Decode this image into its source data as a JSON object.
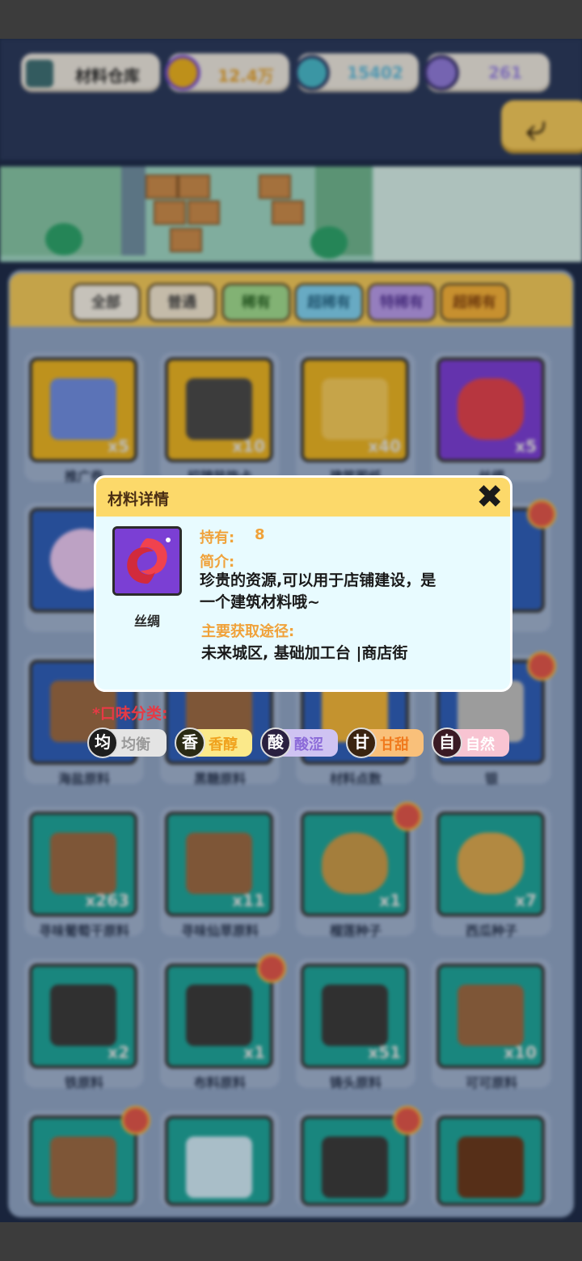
{
  "resources": {
    "warehouse_label": "材料仓库",
    "coins": "12.4万",
    "potion": "15402",
    "gems": "261"
  },
  "tabs": [
    "全部",
    "普通",
    "稀有",
    "超稀有",
    "特稀有",
    "超稀有"
  ],
  "grid": {
    "row1": [
      {
        "name": "推广券",
        "qty": "x5"
      },
      {
        "name": "招牌装饰卡",
        "qty": "x10"
      },
      {
        "name": "建筑图纸",
        "qty": "x40"
      },
      {
        "name": "丝绸",
        "qty": "x5"
      }
    ],
    "row3_names": [
      "海盐原料",
      "黑糖原料",
      "材料点数",
      "银"
    ],
    "row4": [
      {
        "name": "寻味葡萄干原料",
        "qty": "x263"
      },
      {
        "name": "寻味仙草原料",
        "qty": "x11"
      },
      {
        "name": "榴莲种子",
        "qty": "x1"
      },
      {
        "name": "西瓜种子",
        "qty": "x7"
      }
    ],
    "row5": [
      {
        "name": "铁原料",
        "qty": "x2"
      },
      {
        "name": "布料原料",
        "qty": "x1"
      },
      {
        "name": "铸头原料",
        "qty": "x51"
      },
      {
        "name": "可可原料",
        "qty": "x10"
      }
    ]
  },
  "dialog": {
    "title": "材料详情",
    "item_name": "丝绸",
    "own_label": "持有:",
    "own_value": "8",
    "intro_label": "简介:",
    "intro_line1": "珍贵的资源,可以用于店铺建设，是",
    "intro_line2": "一个建筑材料哦~",
    "source_label": "主要获取途径:",
    "source_text": "未来城区, 基础加工台 |商店街"
  },
  "taste": {
    "heading": "*口味分类:",
    "items": [
      {
        "char": "均",
        "label": "均衡"
      },
      {
        "char": "香",
        "label": "香醇"
      },
      {
        "char": "酸",
        "label": "酸涩"
      },
      {
        "char": "甘",
        "label": "甘甜"
      },
      {
        "char": "自",
        "label": "自然"
      }
    ]
  },
  "colors": {
    "dialog_header": "#fcd96a",
    "dialog_body": "#e8fbff",
    "label_orange": "#f0a23a",
    "taste_heading": "#e63a45"
  },
  "icons": [
    "warehouse-icon",
    "coin-icon",
    "potion-icon",
    "gem-icon",
    "back-arrow-icon",
    "close-icon",
    "silk-icon"
  ]
}
